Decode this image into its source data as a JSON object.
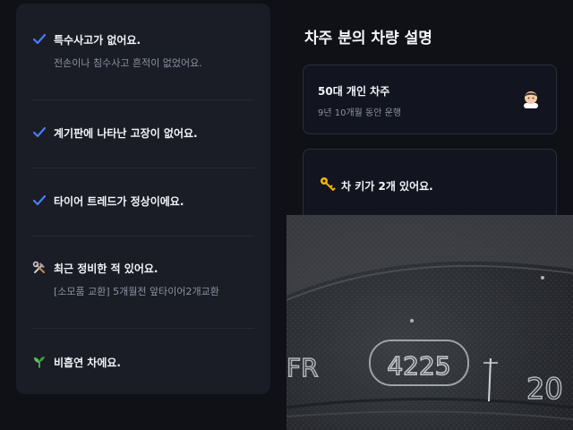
{
  "checklist": [
    {
      "icon": "check-icon",
      "title": "특수사고가 없어요.",
      "sub": "전손이나 침수사고 흔적이 없었어요."
    },
    {
      "icon": "check-icon",
      "title": "계기판에 나타난 고장이 없어요.",
      "sub": ""
    },
    {
      "icon": "check-icon",
      "title": "타이어 트레드가 정상이에요.",
      "sub": ""
    },
    {
      "icon": "tools-icon",
      "title": "최근 정비한 적 있어요.",
      "sub": "[소모품 교환] 5개월전 앞타이어2개교환"
    },
    {
      "icon": "seedling-icon",
      "title": "비흡연 차에요.",
      "sub": ""
    }
  ],
  "owner_section": {
    "title": "차주 분의 차량 설명",
    "owner_name": "50대 개인 차주",
    "owner_period": "9년 10개월 동안 운행",
    "key_text": "차 키가 2개 있어요."
  },
  "photo": {
    "tire_code": "4225",
    "tire_left_mark": "FR",
    "tire_right_mark": "20"
  },
  "colors": {
    "accent_check": "#4a7cf7",
    "background": "#0f1117",
    "card": "#1a1d26"
  }
}
